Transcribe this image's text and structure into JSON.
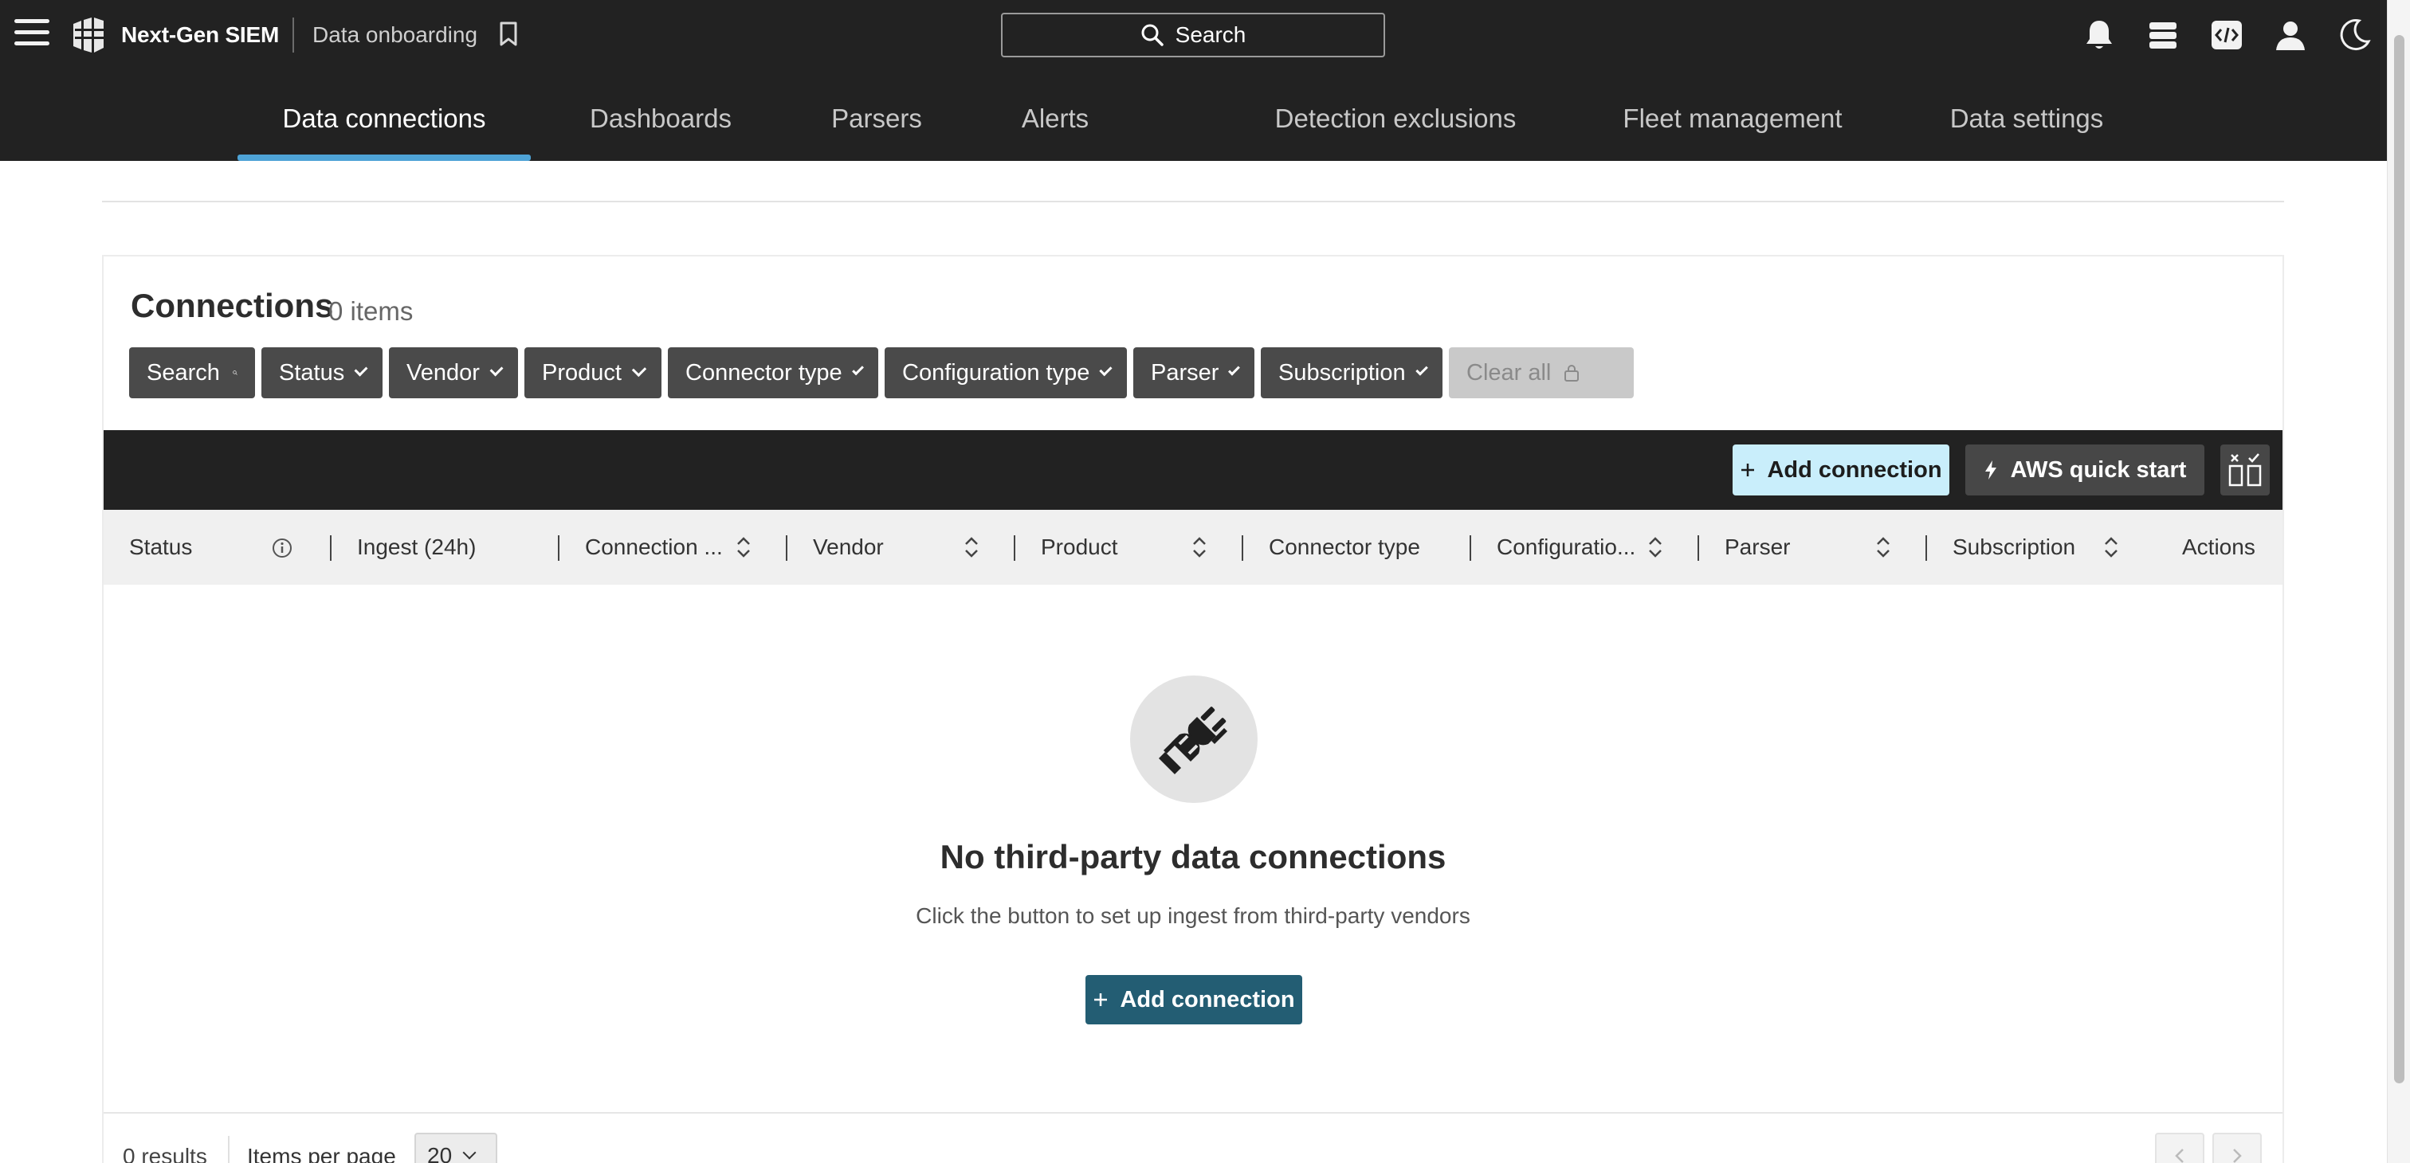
{
  "header": {
    "app_name": "Next-Gen SIEM",
    "section": "Data onboarding",
    "search_label": "Search"
  },
  "icons": {
    "menu": "hamburger-menu-icon",
    "logo": "falcon-logo-icon",
    "bookmark": "bookmark-icon",
    "search": "search-icon",
    "notifications": "bell-icon",
    "stack": "stack-icon",
    "developer": "code-icon",
    "user": "user-icon",
    "theme": "moon-icon",
    "empty_state": "unplugged-icon"
  },
  "tabs": [
    {
      "label": "Data connections",
      "active": true
    },
    {
      "label": "Dashboards",
      "active": false
    },
    {
      "label": "Parsers",
      "active": false
    },
    {
      "label": "Alerts",
      "active": false
    },
    {
      "label": "Detection exclusions",
      "active": false
    },
    {
      "label": "Fleet management",
      "active": false
    },
    {
      "label": "Data settings",
      "active": false
    }
  ],
  "connections": {
    "title": "Connections",
    "count": "0 items",
    "filters": [
      "Search",
      "Status",
      "Vendor",
      "Product",
      "Connector type",
      "Configuration type",
      "Parser",
      "Subscription"
    ],
    "clear_all": "Clear all",
    "add_connection": "Add connection",
    "aws_quick_start": "AWS quick start",
    "columns": [
      "Status",
      "Ingest (24h)",
      "Connection ...",
      "Vendor",
      "Product",
      "Connector type",
      "Configuratio...",
      "Parser",
      "Subscription",
      "Actions"
    ]
  },
  "empty_state": {
    "title": "No third-party data connections",
    "description": "Click the button to set up ingest from third-party vendors",
    "button": "Add connection"
  },
  "footer": {
    "results": "0 results",
    "items_per_page_label": "Items per page",
    "items_per_page_value": "20"
  },
  "colors": {
    "header_bg": "#222222",
    "tab_active_underline": "#4ea3d6",
    "primary_button": "#235d73",
    "light_button": "#c9eefb",
    "filter_button": "#4a4a4a"
  }
}
